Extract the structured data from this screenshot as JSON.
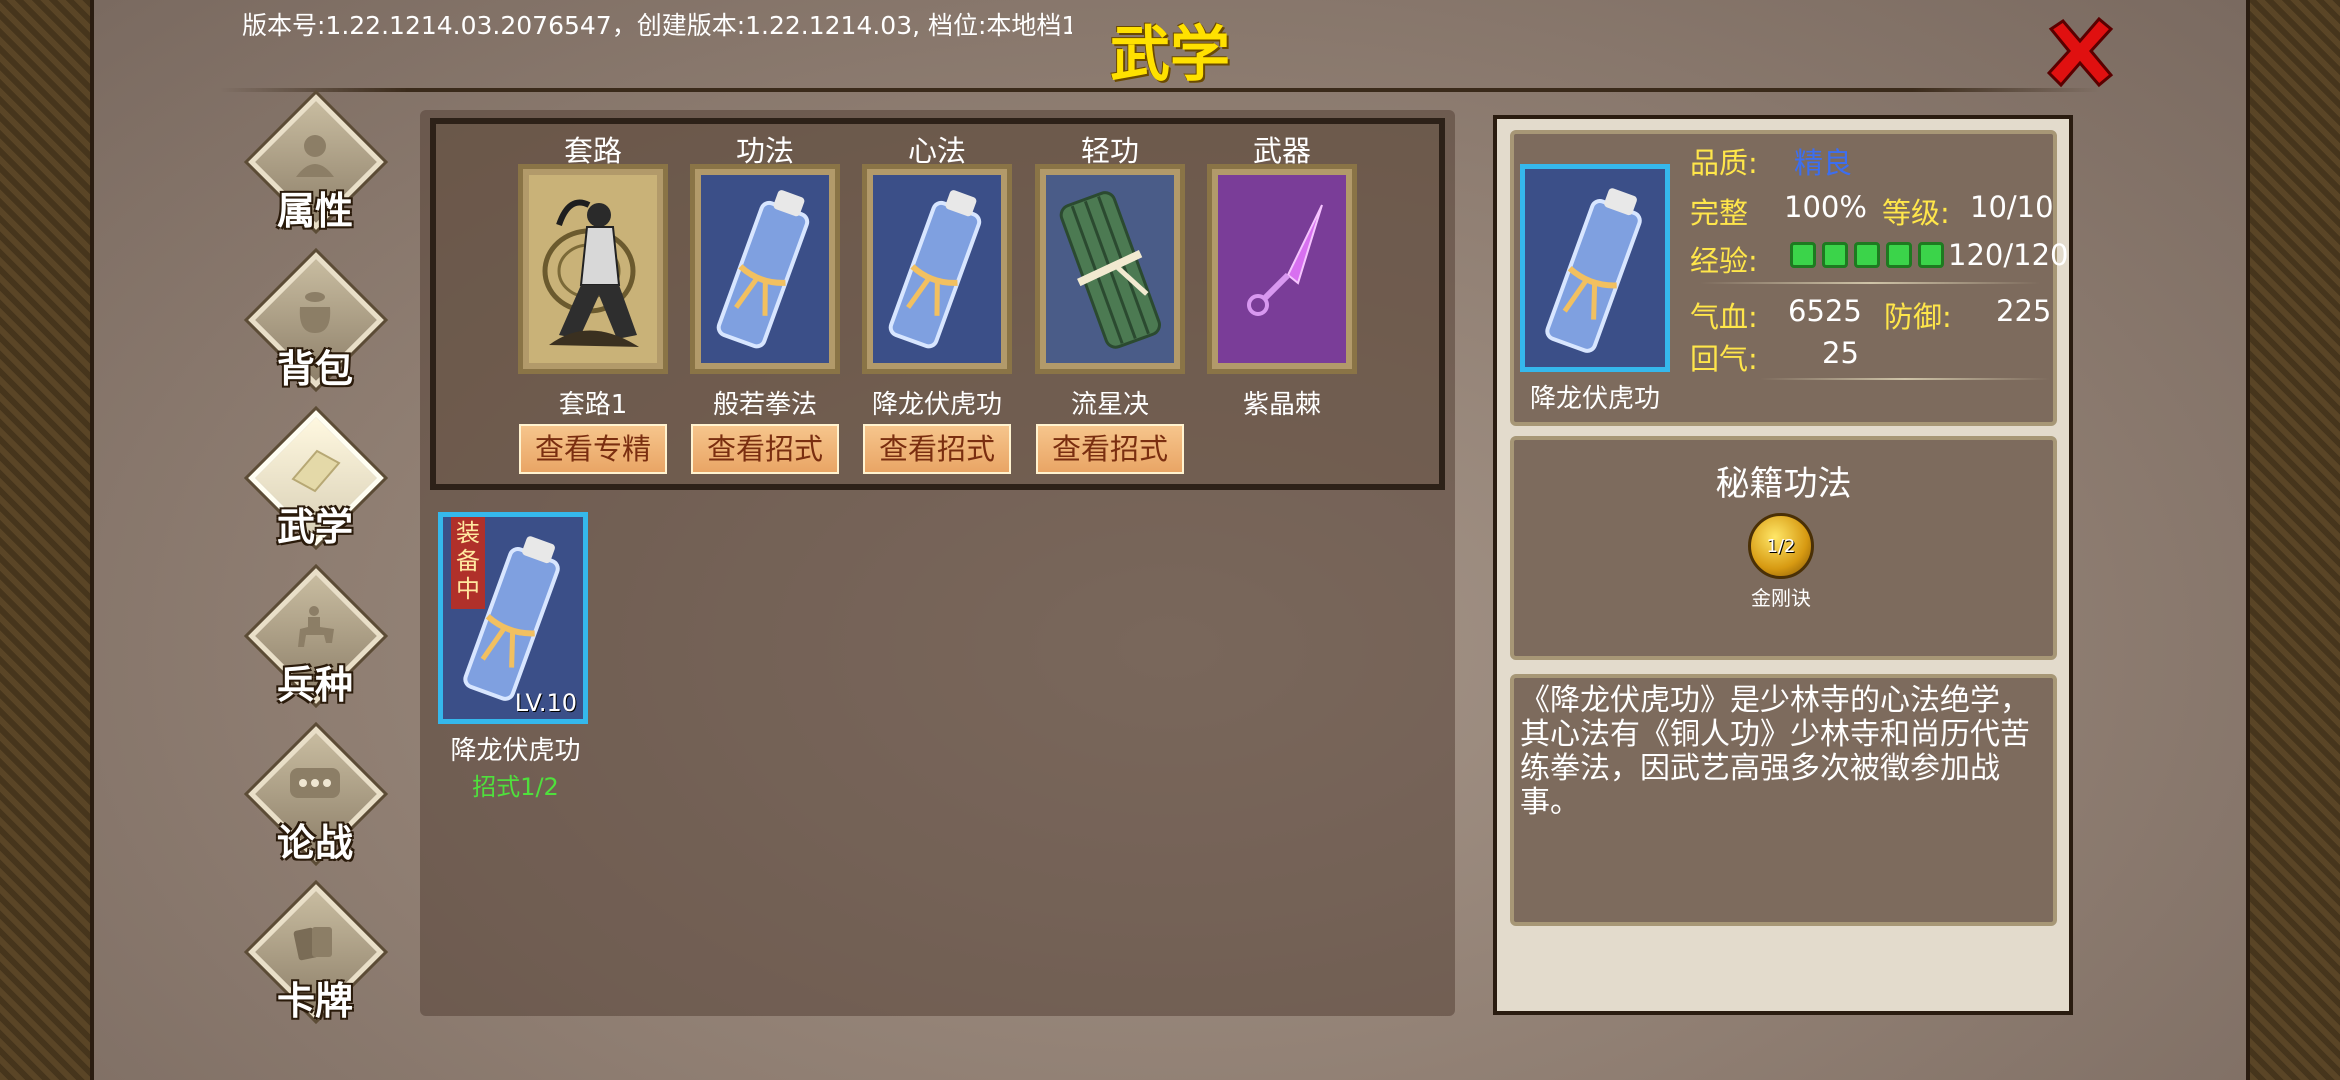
{
  "header": {
    "version_text": "版本号:1.22.1214.03.2076547，创建版本:1.22.1214.03, 档位:本地档1",
    "title": "武学",
    "close_icon": "close-x-icon",
    "title_color": "#ffe100"
  },
  "sidebar": {
    "items": [
      {
        "label": "属性",
        "icon": "person-icon"
      },
      {
        "label": "背包",
        "icon": "bag-icon"
      },
      {
        "label": "武学",
        "icon": "book-icon",
        "active": true
      },
      {
        "label": "兵种",
        "icon": "cavalry-icon"
      },
      {
        "label": "论战",
        "icon": "chat-icon"
      },
      {
        "label": "卡牌",
        "icon": "cards-icon"
      }
    ]
  },
  "equipment": {
    "slots": [
      {
        "header": "套路",
        "name": "套路1",
        "icon": "martial-artist-icon",
        "button": "查看专精"
      },
      {
        "header": "功法",
        "name": "般若拳法",
        "icon": "scroll-icon",
        "button": "查看招式"
      },
      {
        "header": "心法",
        "name": "降龙伏虎功",
        "icon": "scroll-icon",
        "button": "查看招式"
      },
      {
        "header": "轻功",
        "name": "流星决",
        "icon": "bamboo-scroll-icon",
        "button": "查看招式"
      },
      {
        "header": "武器",
        "name": "紫晶棘",
        "icon": "kunai-icon",
        "button": ""
      }
    ]
  },
  "inventory": {
    "items": [
      {
        "name": "降龙伏虎功",
        "badge": "装备中",
        "level": "LV.10",
        "sub": "招式1/2",
        "icon": "scroll-icon"
      }
    ]
  },
  "detail": {
    "name": "降龙伏虎功",
    "quality_label": "品质:",
    "quality_value": "精良",
    "integrity_label": "完整",
    "integrity_value": "100%",
    "level_label": "等级:",
    "level_value": "10/10",
    "exp_label": "经验:",
    "exp_value": "120/120",
    "exp_pips": 5,
    "hp_label": "气血:",
    "hp_value": "6525",
    "def_label": "防御:",
    "def_value": "225",
    "regen_label": "回气:",
    "regen_value": "25",
    "secret_title": "秘籍功法",
    "secret_progress": "1/2",
    "secret_name": "金刚诀",
    "description": "《降龙伏虎功》是少林寺的心法绝学，其心法有《铜人功》少林寺和尚历代苦练拳法，因武艺高强多次被徵参加战事。"
  }
}
